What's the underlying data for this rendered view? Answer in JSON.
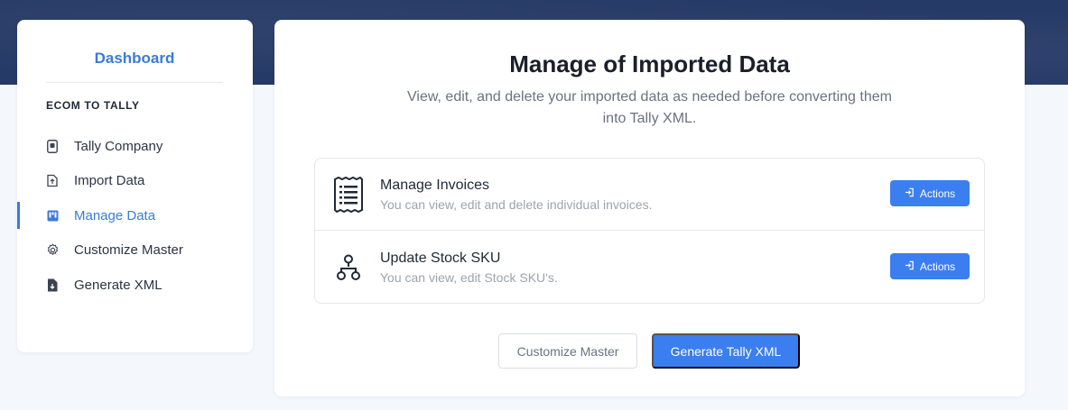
{
  "sidebar": {
    "title": "Dashboard",
    "section": "ECOM TO TALLY",
    "items": [
      {
        "label": "Tally Company",
        "icon": "company-icon"
      },
      {
        "label": "Import Data",
        "icon": "import-icon"
      },
      {
        "label": "Manage Data",
        "icon": "manage-data-icon",
        "active": true
      },
      {
        "label": "Customize Master",
        "icon": "gear-icon"
      },
      {
        "label": "Generate XML",
        "icon": "file-download-icon"
      }
    ]
  },
  "main": {
    "title": "Manage of Imported Data",
    "subtitle": "View, edit, and delete your imported data as needed before converting them into Tally XML.",
    "rows": [
      {
        "title": "Manage Invoices",
        "description": "You can view, edit and delete individual invoices.",
        "action": "Actions",
        "icon": "receipt-icon"
      },
      {
        "title": "Update Stock SKU",
        "description": "You can view, edit Stock SKU's.",
        "action": "Actions",
        "icon": "hierarchy-icon"
      }
    ],
    "buttons": {
      "customize": "Customize Master",
      "generate": "Generate Tally XML"
    }
  },
  "colors": {
    "accent": "#3b7ef0",
    "header_band": "#253a66",
    "active_text": "#3b7ad9"
  }
}
